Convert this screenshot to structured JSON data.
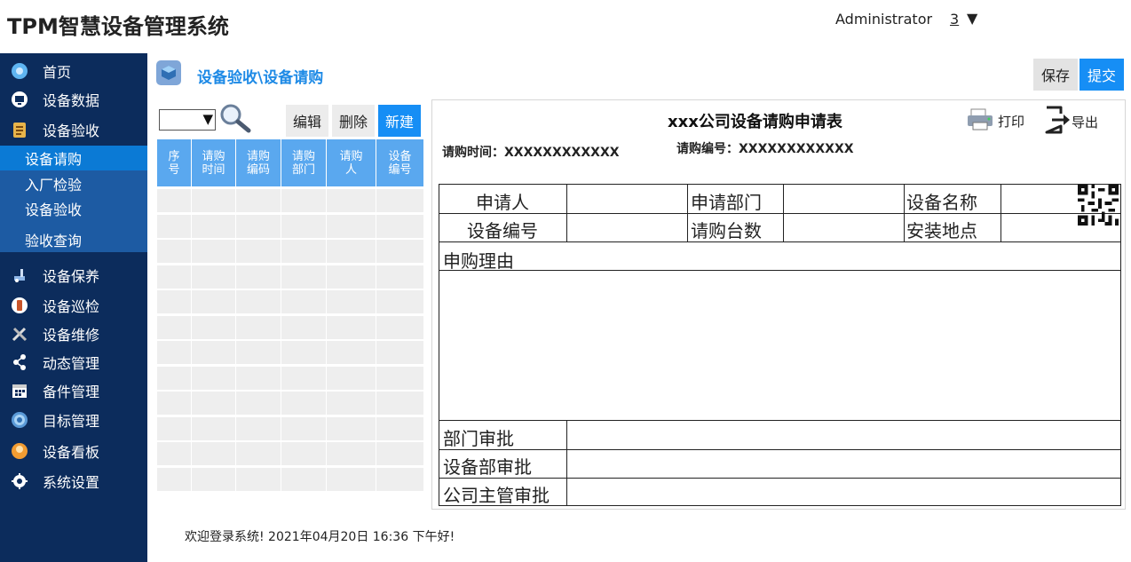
{
  "app_title": "TPM智慧设备管理系统",
  "user": {
    "name": "Administrator",
    "badge": "3",
    "caret": "▼"
  },
  "sidebar": {
    "items": [
      {
        "label": "首页",
        "icon": "home-icon"
      },
      {
        "label": "设备数据",
        "icon": "monitor-icon"
      },
      {
        "label": "设备验收",
        "icon": "clipboard-icon"
      },
      {
        "label": "设备保养",
        "icon": "maintenance-icon"
      },
      {
        "label": "设备巡检",
        "icon": "inspection-icon"
      },
      {
        "label": "设备维修",
        "icon": "tools-icon"
      },
      {
        "label": "动态管理",
        "icon": "share-icon"
      },
      {
        "label": "备件管理",
        "icon": "calendar-icon"
      },
      {
        "label": "目标管理",
        "icon": "target-icon"
      },
      {
        "label": "设备看板",
        "icon": "dashboard-icon"
      },
      {
        "label": "系统设置",
        "icon": "gear-icon"
      }
    ],
    "sub_items": [
      {
        "label": "设备请购"
      },
      {
        "label": "入厂检验"
      },
      {
        "label": "设备验收"
      },
      {
        "label": "验收查询"
      }
    ]
  },
  "header": {
    "breadcrumb": "设备验收\\设备请购",
    "save_label": "保存",
    "submit_label": "提交"
  },
  "list": {
    "dropdown_caret": "▼",
    "edit_label": "编辑",
    "delete_label": "删除",
    "new_label": "新建",
    "columns": [
      "序号",
      "请购时间",
      "请购编码",
      "请购部门",
      "请购人",
      "设备编号"
    ],
    "column_lines": [
      [
        "序",
        "号"
      ],
      [
        "请购",
        "时间"
      ],
      [
        "请购",
        "编码"
      ],
      [
        "请购",
        "部门"
      ],
      [
        "请购",
        "人"
      ],
      [
        "设备",
        "编号"
      ]
    ],
    "empty_rows": 12
  },
  "form": {
    "title": "xxx公司设备请购申请表",
    "print_label": "打印",
    "export_label": "导出",
    "request_time": "请购时间：XXXXXXXXXXXX",
    "request_no": "请购编号：XXXXXXXXXXXX",
    "labels": {
      "applicant": "申请人",
      "department": "申请部门",
      "equipment_name": "设备名称",
      "equipment_no": "设备编号",
      "quantity": "请购台数",
      "location": "安装地点",
      "reason": "申购理由",
      "dept_approval": "部门审批",
      "equip_dept_approval": "设备部审批",
      "supervisor_approval": "公司主管审批"
    }
  },
  "footer": {
    "text": "欢迎登录系统!   2021年04月20日 16:36 下午好!"
  },
  "colors": {
    "sidebar": "#0c2c5c",
    "submenu": "#1d5ba3",
    "active": "#0b7ad5",
    "accent": "#168ef5",
    "header_blue": "#5aa8ef"
  }
}
